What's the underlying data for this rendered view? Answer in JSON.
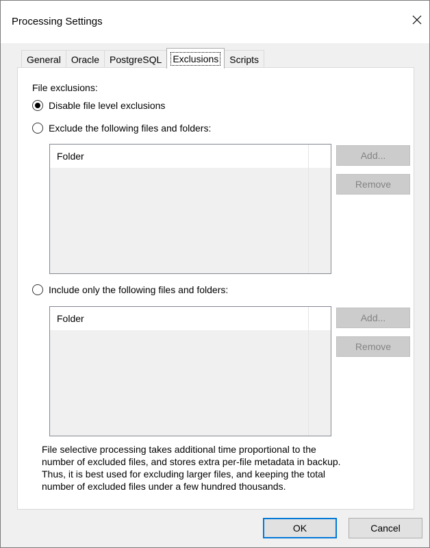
{
  "window": {
    "title": "Processing Settings"
  },
  "tabs": [
    {
      "label": "General"
    },
    {
      "label": "Oracle"
    },
    {
      "label": "PostgreSQL"
    },
    {
      "label": "Exclusions",
      "active": true
    },
    {
      "label": "Scripts"
    }
  ],
  "exclusions": {
    "section_label": "File exclusions:",
    "options": [
      {
        "label": "Disable file level exclusions",
        "checked": true
      },
      {
        "label": "Exclude the following files and folders:",
        "checked": false
      },
      {
        "label": "Include only the following files and folders:",
        "checked": false
      }
    ],
    "exclude_list": {
      "column_header": "Folder",
      "add_label": "Add...",
      "remove_label": "Remove"
    },
    "include_list": {
      "column_header": "Folder",
      "add_label": "Add...",
      "remove_label": "Remove"
    },
    "note_lines": [
      "File selective processing takes additional time proportional to the",
      "number of excluded files, and stores extra per-file metadata in backup.",
      "Thus, it is best used for excluding larger files, and keeping the total",
      "number of excluded files under a few hundred thousands."
    ]
  },
  "footer": {
    "ok_label": "OK",
    "cancel_label": "Cancel"
  },
  "colors": {
    "accent": "#0078d7",
    "disabled_button": "#cccccc",
    "disabled_text": "#838383"
  }
}
